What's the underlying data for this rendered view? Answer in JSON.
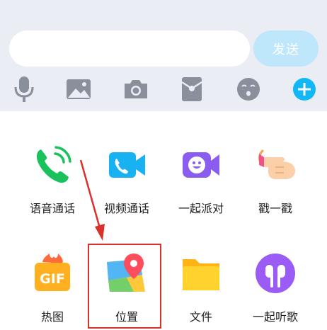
{
  "input_bar": {
    "message_value": "",
    "send_label": "发送"
  },
  "toolbar": {
    "tools": [
      {
        "icon": "microphone-icon"
      },
      {
        "icon": "image-icon"
      },
      {
        "icon": "camera-icon"
      },
      {
        "icon": "red-packet-icon"
      },
      {
        "icon": "emoji-icon"
      },
      {
        "icon": "plus-icon"
      }
    ]
  },
  "panel": {
    "items": [
      {
        "label": "语音通话",
        "icon": "phone-call-icon"
      },
      {
        "label": "视频通话",
        "icon": "video-call-icon"
      },
      {
        "label": "一起派对",
        "icon": "party-icon"
      },
      {
        "label": "戳一戳",
        "icon": "poke-icon"
      },
      {
        "label": "热图",
        "icon": "gif-icon"
      },
      {
        "label": "位置",
        "icon": "location-icon"
      },
      {
        "label": "文件",
        "icon": "folder-icon"
      },
      {
        "label": "一起听歌",
        "icon": "headphones-icon"
      }
    ]
  },
  "colors": {
    "panel_bg": "#ebedf5",
    "accent_blue": "#12b7f5",
    "send_disabled": "#bfe7fb",
    "highlight_red": "#d9312b"
  }
}
